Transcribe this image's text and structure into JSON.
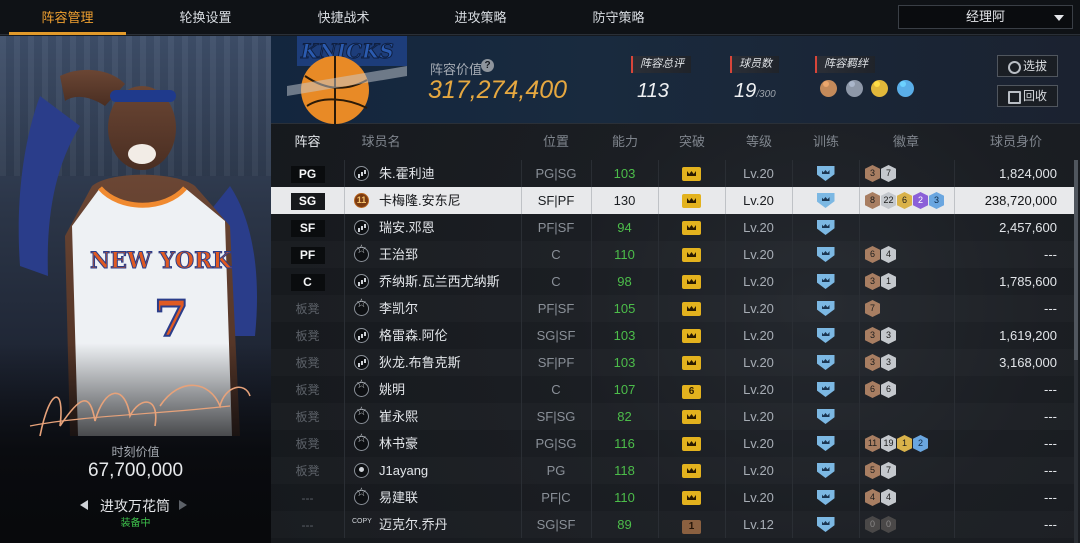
{
  "tabs": [
    {
      "label": "阵容管理",
      "active": true
    },
    {
      "label": "轮换设置",
      "active": false
    },
    {
      "label": "快捷战术",
      "active": false
    },
    {
      "label": "进攻策略",
      "active": false
    },
    {
      "label": "防守策略",
      "active": false
    }
  ],
  "manager_dropdown": "经理阿",
  "player_card": {
    "jersey_team": "NEW YORK",
    "jersey_number": "7",
    "value_label": "时刻价值",
    "value": "67,700,000",
    "skill": "进攻万花筒",
    "skill_status": "装备中"
  },
  "team": {
    "logo_text": "KNICKS",
    "value_label": "阵容价值",
    "value": "317,274,400",
    "stats": [
      {
        "label": "阵容总评",
        "value": "113",
        "suffix": ""
      },
      {
        "label": "球员数",
        "value": "19",
        "suffix": "/300"
      },
      {
        "label": "阵容羁绊",
        "value": "",
        "suffix": ""
      }
    ],
    "synergy_icons": [
      {
        "icon": "synergy-people-icon",
        "color": "#c48a5a"
      },
      {
        "icon": "synergy-people-icon",
        "color": "#8e98a8"
      },
      {
        "icon": "synergy-people-icon",
        "color": "#e2b83a"
      },
      {
        "icon": "synergy-people-icon",
        "color": "#5aaee8"
      }
    ],
    "scout_button": "选拔",
    "recall_button": "回收"
  },
  "table_headers": [
    "阵容",
    "球员名",
    "位置",
    "能力",
    "突破",
    "等级",
    "训练",
    "徽章",
    "球员身价"
  ],
  "rows": [
    {
      "slot": "PG",
      "starter": true,
      "role": "bars",
      "name": "朱.霍利迪",
      "pos": "PG|SG",
      "ability": "103",
      "green": true,
      "breakthrough": "",
      "level": "Lv.20",
      "badges": [
        {
          "t": "bronze",
          "n": "3"
        },
        {
          "t": "silver",
          "n": "7"
        }
      ],
      "value": "1,824,000",
      "selected": false
    },
    {
      "slot": "SG",
      "starter": true,
      "role": "num",
      "role_text": "11",
      "name": "卡梅隆.安东尼",
      "pos": "SF|PF",
      "ability": "130",
      "green": false,
      "breakthrough": "",
      "level": "Lv.20",
      "badges": [
        {
          "t": "bronze",
          "n": "8"
        },
        {
          "t": "silver",
          "n": "22"
        },
        {
          "t": "gold",
          "n": "6"
        },
        {
          "t": "purple",
          "n": "2"
        },
        {
          "t": "blue",
          "n": "3"
        }
      ],
      "value": "238,720,000",
      "selected": true
    },
    {
      "slot": "SF",
      "starter": true,
      "role": "bars",
      "name": "瑞安.邓恩",
      "pos": "PF|SF",
      "ability": "94",
      "green": true,
      "breakthrough": "",
      "level": "Lv.20",
      "badges": [],
      "value": "2,457,600",
      "selected": false
    },
    {
      "slot": "PF",
      "starter": true,
      "role": "star",
      "name": "王治郅",
      "pos": "C",
      "ability": "110",
      "green": true,
      "breakthrough": "",
      "level": "Lv.20",
      "badges": [
        {
          "t": "bronze",
          "n": "6"
        },
        {
          "t": "silver",
          "n": "4"
        }
      ],
      "value": "---",
      "selected": false
    },
    {
      "slot": "C",
      "starter": true,
      "role": "bars",
      "name": "乔纳斯.瓦兰西尤纳斯",
      "pos": "C",
      "ability": "98",
      "green": true,
      "breakthrough": "",
      "level": "Lv.20",
      "badges": [
        {
          "t": "bronze",
          "n": "3"
        },
        {
          "t": "silver",
          "n": "1"
        }
      ],
      "value": "1,785,600",
      "selected": false
    },
    {
      "slot": "板凳",
      "starter": false,
      "role": "star",
      "name": "李凯尔",
      "pos": "PF|SF",
      "ability": "105",
      "green": true,
      "breakthrough": "",
      "level": "Lv.20",
      "badges": [
        {
          "t": "bronze",
          "n": "7"
        }
      ],
      "value": "---",
      "selected": false
    },
    {
      "slot": "板凳",
      "starter": false,
      "role": "bars",
      "name": "格雷森.阿伦",
      "pos": "SG|SF",
      "ability": "103",
      "green": true,
      "breakthrough": "",
      "level": "Lv.20",
      "badges": [
        {
          "t": "bronze",
          "n": "3"
        },
        {
          "t": "silver",
          "n": "3"
        }
      ],
      "value": "1,619,200",
      "selected": false
    },
    {
      "slot": "板凳",
      "starter": false,
      "role": "bars",
      "name": "狄龙.布鲁克斯",
      "pos": "SF|PF",
      "ability": "103",
      "green": true,
      "breakthrough": "",
      "level": "Lv.20",
      "badges": [
        {
          "t": "bronze",
          "n": "3"
        },
        {
          "t": "silver",
          "n": "3"
        }
      ],
      "value": "3,168,000",
      "selected": false
    },
    {
      "slot": "板凳",
      "starter": false,
      "role": "star",
      "name": "姚明",
      "pos": "C",
      "ability": "107",
      "green": true,
      "breakthrough": "6",
      "level": "Lv.20",
      "badges": [
        {
          "t": "bronze",
          "n": "6"
        },
        {
          "t": "silver",
          "n": "6"
        }
      ],
      "value": "---",
      "selected": false
    },
    {
      "slot": "板凳",
      "starter": false,
      "role": "star",
      "name": "崔永熙",
      "pos": "SF|SG",
      "ability": "82",
      "green": true,
      "breakthrough": "",
      "level": "Lv.20",
      "badges": [],
      "value": "---",
      "selected": false
    },
    {
      "slot": "板凳",
      "starter": false,
      "role": "star",
      "name": "林书豪",
      "pos": "PG|SG",
      "ability": "116",
      "green": true,
      "breakthrough": "",
      "level": "Lv.20",
      "badges": [
        {
          "t": "bronze",
          "n": "11"
        },
        {
          "t": "silver",
          "n": "19"
        },
        {
          "t": "gold",
          "n": "1"
        },
        {
          "t": "blue",
          "n": "2"
        }
      ],
      "value": "---",
      "selected": false
    },
    {
      "slot": "板凳",
      "starter": false,
      "role": "person",
      "name": "J1ayang",
      "pos": "PG",
      "ability": "118",
      "green": true,
      "breakthrough": "",
      "level": "Lv.20",
      "badges": [
        {
          "t": "bronze",
          "n": "5"
        },
        {
          "t": "silver",
          "n": "7"
        }
      ],
      "value": "---",
      "selected": false
    },
    {
      "slot": "---",
      "starter": false,
      "role": "star",
      "name": "易建联",
      "pos": "PF|C",
      "ability": "110",
      "green": true,
      "breakthrough": "",
      "level": "Lv.20",
      "badges": [
        {
          "t": "bronze",
          "n": "4"
        },
        {
          "t": "silver",
          "n": "4"
        }
      ],
      "value": "---",
      "selected": false
    },
    {
      "slot": "---",
      "starter": false,
      "role": "copy",
      "name": "迈克尔.乔丹",
      "pos": "SG|SF",
      "ability": "89",
      "green": true,
      "breakthrough": "1",
      "brown": true,
      "level": "Lv.12",
      "badges": [
        {
          "t": "dark",
          "n": "0"
        },
        {
          "t": "dark",
          "n": "0"
        }
      ],
      "value": "---",
      "selected": false
    }
  ]
}
